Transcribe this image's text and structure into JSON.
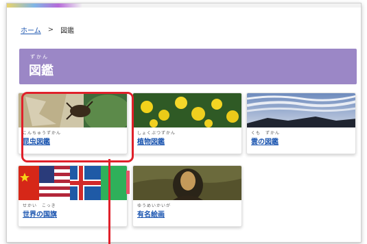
{
  "breadcrumb": {
    "home": "ホーム",
    "separator": ">",
    "current": "図鑑"
  },
  "header": {
    "ruby": "ずかん",
    "title": "図鑑",
    "background": "#9b87c6"
  },
  "cards": [
    {
      "ruby": "こんちゅうずかん",
      "label": "昆虫図鑑",
      "image": "insect-photo"
    },
    {
      "ruby": "しょくぶつずかん",
      "label": "植物図鑑",
      "image": "plant-photo"
    },
    {
      "ruby": "くも　ずかん",
      "label": "雲の図鑑",
      "image": "cloud-photo"
    },
    {
      "ruby": "せかい　こっき",
      "label": "世界の国旗",
      "image": "flags-photo"
    },
    {
      "ruby": "ゆうめいかいが",
      "label": "有名絵画",
      "image": "painting-photo"
    }
  ],
  "highlight_color": "#e0202a",
  "link_color": "#1b55b0"
}
